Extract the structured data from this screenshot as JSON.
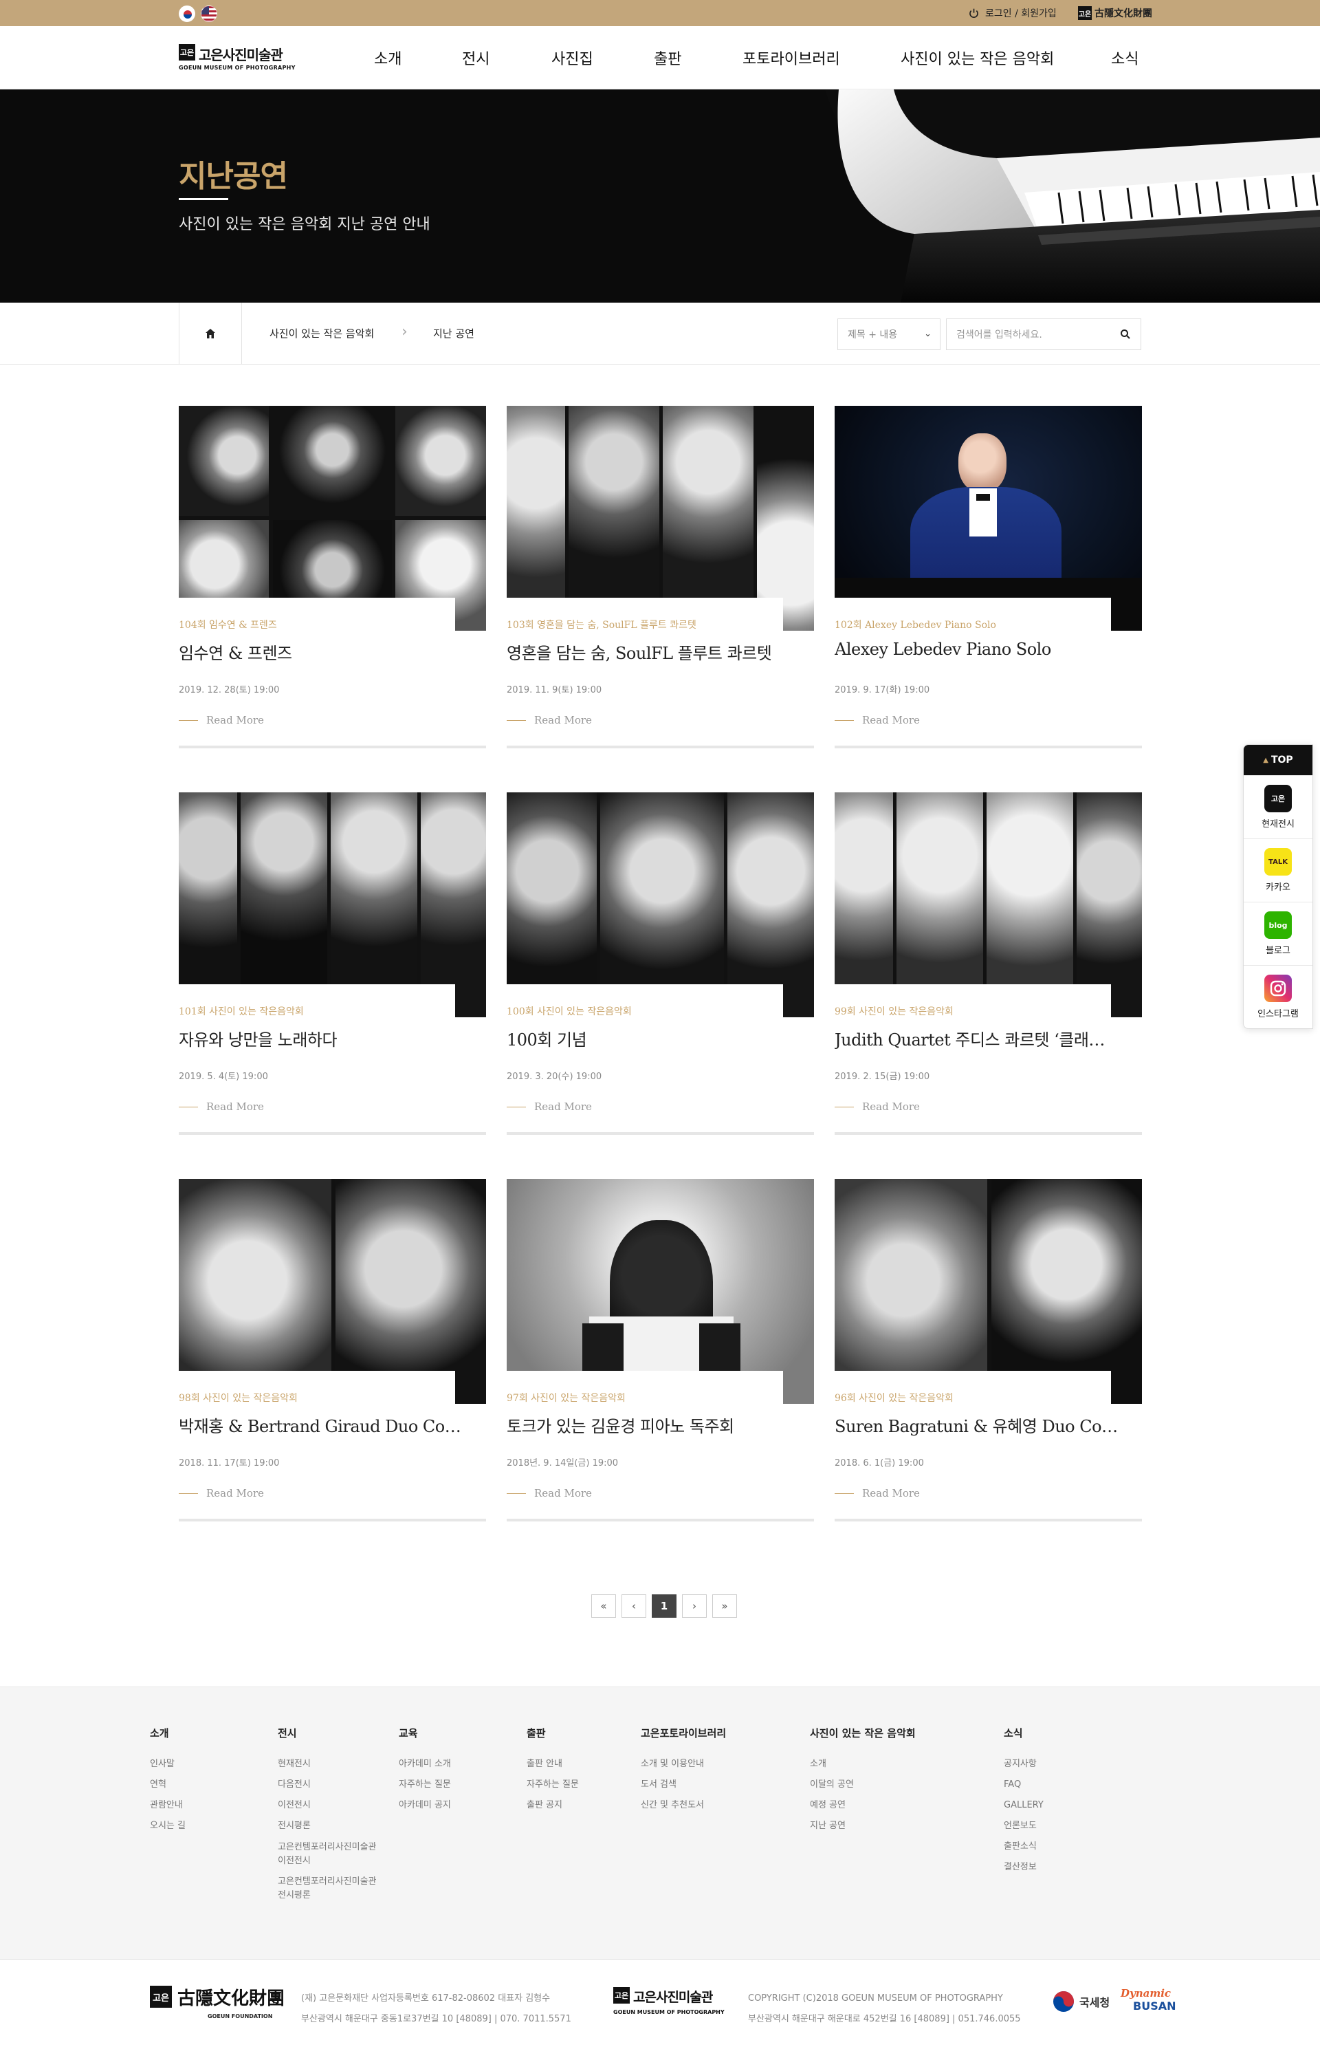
{
  "topbar": {
    "login": "로그인 / 회원가입",
    "foundation": "古隱文化財團",
    "foundation_mark": "고은"
  },
  "header": {
    "logo_mark": "고은",
    "logo_kr": "고은사진미술관",
    "logo_en": "GOEUN MUSEUM OF PHOTOGRAPHY",
    "nav": [
      "소개",
      "전시",
      "사진집",
      "출판",
      "포토라이브러리",
      "사진이 있는 작은 음악회",
      "소식"
    ]
  },
  "hero": {
    "title": "지난공연",
    "subtitle": "사진이 있는 작은 음악회 지난 공연 안내"
  },
  "breadcrumb": {
    "items": [
      "사진이 있는 작은 음악회",
      "지난 공연"
    ]
  },
  "search": {
    "select": "제목 + 내용",
    "placeholder": "검색어를 입력하세요."
  },
  "cards": [
    {
      "category": "104회 임수연 & 프렌즈",
      "title": "임수연 & 프렌즈",
      "date": "2019. 12. 28(토) 19:00",
      "more": "Read More"
    },
    {
      "category": "103회 영혼을 담는 숨, SoulFL 플루트 콰르텟",
      "title": "영혼을 담는 숨, SoulFL 플루트 콰르텟",
      "date": "2019. 11. 9(토) 19:00",
      "more": "Read More"
    },
    {
      "category": "102회 Alexey Lebedev Piano Solo",
      "title": "Alexey Lebedev Piano Solo",
      "date": "2019. 9. 17(화) 19:00",
      "more": "Read More"
    },
    {
      "category": "101회 사진이 있는 작은음악회",
      "title": "자유와 낭만을 노래하다",
      "date": "2019. 5. 4(토) 19:00",
      "more": "Read More"
    },
    {
      "category": "100회 사진이 있는 작은음악회",
      "title": "100회 기념",
      "date": "2019. 3. 20(수) 19:00",
      "more": "Read More"
    },
    {
      "category": "99회 사진이 있는 작은음악회",
      "title": "Judith Quartet 주디스 콰르텟 ‘클래…",
      "date": "2019. 2. 15(금) 19:00",
      "more": "Read More"
    },
    {
      "category": "98회 사진이 있는 작은음악회",
      "title": "박재홍 & Bertrand Giraud Duo Co…",
      "date": "2018. 11. 17(토) 19:00",
      "more": "Read More"
    },
    {
      "category": "97회 사진이 있는 작은음악회",
      "title": "토크가 있는 김윤경 피아노 독주회",
      "date": "2018년. 9. 14일(금) 19:00",
      "more": "Read More"
    },
    {
      "category": "96회 사진이 있는 작은음악회",
      "title": "Suren Bagratuni & 유혜영 Duo Co…",
      "date": "2018. 6. 1(금) 19:00",
      "more": "Read More"
    }
  ],
  "quick": {
    "top": "TOP",
    "items": [
      {
        "label": "현재전시",
        "icon": "고은"
      },
      {
        "label": "카카오",
        "icon": "TALK"
      },
      {
        "label": "블로그",
        "icon": "blog"
      },
      {
        "label": "인스타그램",
        "icon": "instagram-icon"
      }
    ]
  },
  "pager": {
    "first": "«",
    "prev": "‹",
    "current": "1",
    "next": "›",
    "last": "»"
  },
  "footer": {
    "columns": [
      {
        "title": "소개",
        "items": [
          "인사말",
          "연혁",
          "관람안내",
          "오시는 길"
        ]
      },
      {
        "title": "전시",
        "items": [
          "현재전시",
          "다음전시",
          "이전전시",
          "전시평론",
          "고은컨템포러리사진미술관",
          "이전전시",
          "고은컨템포러리사진미술관",
          "전시평론"
        ]
      },
      {
        "title": "교육",
        "items": [
          "아카데미 소개",
          "자주하는 질문",
          "아카데미 공지"
        ]
      },
      {
        "title": "출판",
        "items": [
          "출판 안내",
          "자주하는 질문",
          "출판 공지"
        ]
      },
      {
        "title": "고은포토라이브러리",
        "items": [
          "소개 및 이용안내",
          "도서 검색",
          "신간 및 추천도서"
        ]
      },
      {
        "title": "사진이 있는 작은 음악회",
        "items": [
          "소개",
          "이달의 공연",
          "예정 공연",
          "지난 공연"
        ]
      },
      {
        "title": "소식",
        "items": [
          "공지사항",
          "FAQ",
          "GALLERY",
          "언론보도",
          "출판소식",
          "결산정보"
        ]
      }
    ],
    "foundation_mark": "고은",
    "foundation_name": "古隱文化財團",
    "foundation_en": "GOEUN FOUNDATION",
    "info1_line1": "(재) 고은문화재단 사업자등록번호 617-82-08602 대표자 김형수",
    "info1_line2": "부산광역시 해운대구 중동1로37번길 10 [48089]  |  070. 7011.5571",
    "museum_mark": "고은",
    "museum_kr": "고은사진미술관",
    "museum_en": "GOEUN MUSEUM OF PHOTOGRAPHY",
    "info2_line1": "COPYRIGHT (C)2018 GOEUN MUSEUM OF PHOTOGRAPHY",
    "info2_line2": "부산광역시 해운대구 해운대로 452번길 16 [48089]  |  051.746.0055",
    "nts": "국세청",
    "busan_a": "Dynamic",
    "busan_b": "BUSAN"
  }
}
